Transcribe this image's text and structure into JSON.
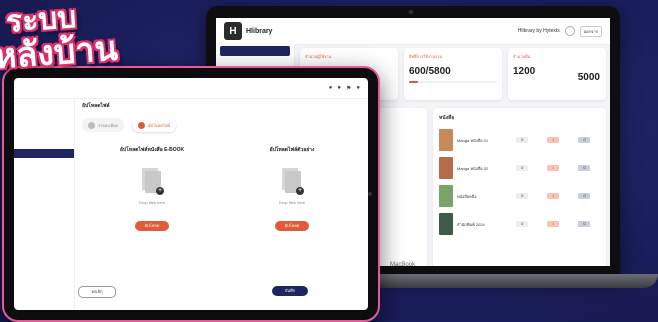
{
  "headline": {
    "line1": "ระบบ",
    "line2": "หลังบ้าน"
  },
  "colors": {
    "accent": "#e05b3a",
    "navy": "#1f2560",
    "tablet_frame": "#e55a97",
    "background": "#1b1f5e"
  },
  "laptop": {
    "brand": "Hlibrary",
    "device_label": "MacBook",
    "user": "Hlibrary by Hytexts",
    "logout": "ออกจาก",
    "stats": [
      {
        "label": "จำนวนผู้ใช้งาน",
        "value": ""
      },
      {
        "label": "สิทธิ์การใช้งานรวม",
        "value": "600/5800",
        "progress": 0.1
      },
      {
        "label": "จำนวนยืม",
        "value": "1200",
        "value2": "5000"
      }
    ],
    "table_header": {
      "book": "หนังสือ"
    },
    "rows": [
      {
        "title": "Manga หนังสือ 01",
        "cover": "#c98a5a",
        "n1": "0",
        "n2": "1",
        "n3": "0"
      },
      {
        "title": "Manga หนังสือ 02",
        "cover": "#b56a48",
        "n1": "0",
        "n2": "1",
        "n3": "0"
      },
      {
        "title": "หนังสือหนึ่ง",
        "cover": "#7aa36a",
        "n1": "0",
        "n2": "1",
        "n3": "0"
      },
      {
        "title": "สำนักพิมพ์ 2024",
        "cover": "#3e5a4a",
        "n1": "0",
        "n2": "1",
        "n3": "0"
      }
    ]
  },
  "tablet": {
    "page_title": "อัปโหลดไฟล์",
    "tabs": [
      {
        "label": "รายละเอียด"
      },
      {
        "label": "อัปโหลดไฟล์"
      }
    ],
    "upload": [
      {
        "title": "อัปโหลดไฟล์หนังสือ E-BOOK",
        "hint": "Drop files here",
        "button": "อัปโหลด"
      },
      {
        "title": "อัปโหลดไฟล์ตัวอย่าง",
        "hint": "Drop files here",
        "button": "อัปโหลด"
      }
    ],
    "cancel_label": "ยกเลิก",
    "save_label": "บันทึก"
  }
}
